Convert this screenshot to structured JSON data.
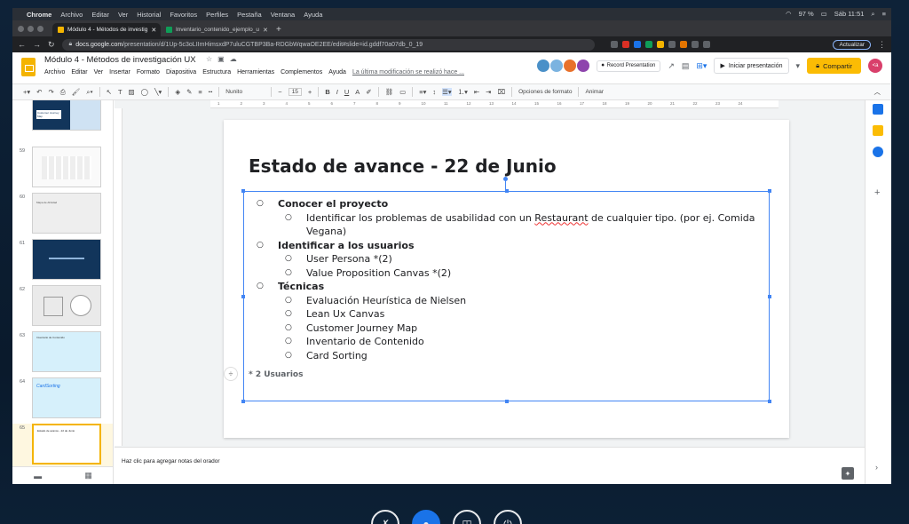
{
  "menubar": {
    "app": "Chrome",
    "items": [
      "Archivo",
      "Editar",
      "Ver",
      "Historial",
      "Favoritos",
      "Perfiles",
      "Pestaña",
      "Ventana",
      "Ayuda"
    ],
    "battery": "97 %",
    "clock": "Sáb 11:51"
  },
  "tabs": [
    {
      "title": "Módulo 4 - Métodos de investig",
      "color": "#f4b400",
      "active": true
    },
    {
      "title": "Inventario_contenido_ejemplo_u",
      "color": "#0f9d58",
      "active": false
    }
  ],
  "address": {
    "host": "docs.google.com",
    "path": "/presentation/d/1Up-5c3oLIImHimsxdP7uluCGTBP3Ba-RDGbWqwaOE2EE/edit#slide=id.gddf70a07db_0_19",
    "update_label": "Actualizar"
  },
  "docs": {
    "title": "Módulo 4 - Métodos de investigación UX",
    "menu": [
      "Archivo",
      "Editar",
      "Ver",
      "Insertar",
      "Formato",
      "Diapositiva",
      "Estructura",
      "Herramientas",
      "Complementos",
      "Ayuda"
    ],
    "last_edit": "La última modificación se realizó hace ...",
    "record_label": "Record Presentation",
    "present_label": "Iniciar presentación",
    "share_label": "Compartir",
    "user_initials": "<a"
  },
  "toolbar": {
    "font": "Nunito",
    "font_size": "15",
    "format_options": "Opciones de formato",
    "animate": "Animar"
  },
  "ruler_ticks": [
    "1",
    "2",
    "3",
    "4",
    "5",
    "6",
    "7",
    "8",
    "9",
    "10",
    "11",
    "12",
    "13",
    "14",
    "15",
    "16",
    "17",
    "18",
    "19",
    "20",
    "21",
    "22",
    "23",
    "24"
  ],
  "slides": [
    {
      "num": "",
      "label": "Customer Journey Map"
    },
    {
      "num": "59",
      "label": ""
    },
    {
      "num": "60",
      "label": "Mapa de Afinidad"
    },
    {
      "num": "61",
      "label": ""
    },
    {
      "num": "62",
      "label": ""
    },
    {
      "num": "63",
      "label": "Inventario de Contenido"
    },
    {
      "num": "64",
      "label": "CardSorting"
    },
    {
      "num": "65",
      "label": "Estado de avance - 22 de Junio"
    }
  ],
  "slide": {
    "title": "Estado de avance - 22 de Junio",
    "sections": [
      {
        "heading": "Conocer el proyecto",
        "items": [
          "Identificar los problemas de usabilidad con un Restaurant de cualquier tipo. (por ej. Comida Vegana)"
        ]
      },
      {
        "heading": "Identificar a los usuarios",
        "items": [
          "User Persona *(2)",
          "Value Proposition Canvas *(2)"
        ]
      },
      {
        "heading": "Técnicas",
        "items": [
          "Evaluación Heurística de Nielsen",
          "Lean Ux Canvas",
          "Customer Journey Map",
          "Inventario de Contenido",
          "Card Sorting"
        ]
      }
    ],
    "footnote": "* 2 Usuarios"
  },
  "notes": {
    "placeholder": "Haz clic para agregar notas del orador"
  }
}
